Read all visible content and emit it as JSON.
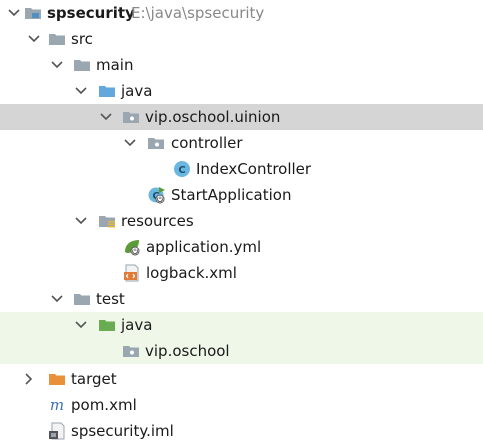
{
  "project": {
    "name": "spsecurity",
    "path": "E:\\java\\spsecurity"
  },
  "tree": {
    "src": "src",
    "main": "main",
    "main_java": "java",
    "package_main": "vip.oschool.uinion",
    "controller": "controller",
    "index_controller": "IndexController",
    "start_application": "StartApplication",
    "resources": "resources",
    "application_yml": "application.yml",
    "logback_xml": "logback.xml",
    "test": "test",
    "test_java": "java",
    "package_test": "vip.oschool",
    "target": "target",
    "pom_xml": "pom.xml",
    "iml": "spsecurity.iml"
  },
  "icons": {
    "project": "module-folder-icon",
    "folder": "folder-icon",
    "source_root": "source-root-folder-icon",
    "package": "package-icon",
    "class": "class-icon",
    "spring_boot_class": "spring-boot-class-icon",
    "resources_root": "resources-folder-icon",
    "spring_config": "spring-config-icon",
    "xml": "xml-file-icon",
    "test_root": "test-root-folder-icon",
    "excluded": "excluded-folder-icon",
    "maven": "maven-icon",
    "iml": "iml-file-icon"
  },
  "colors": {
    "selection": "#d5d5d5",
    "test_background": "#eef7e8",
    "folder": "#9aa7b0",
    "source_folder": "#62a8dc",
    "test_folder": "#6aac52",
    "excluded_folder": "#e8913a",
    "class_icon": "#6bb7e0",
    "spring": "#5b9c39"
  }
}
